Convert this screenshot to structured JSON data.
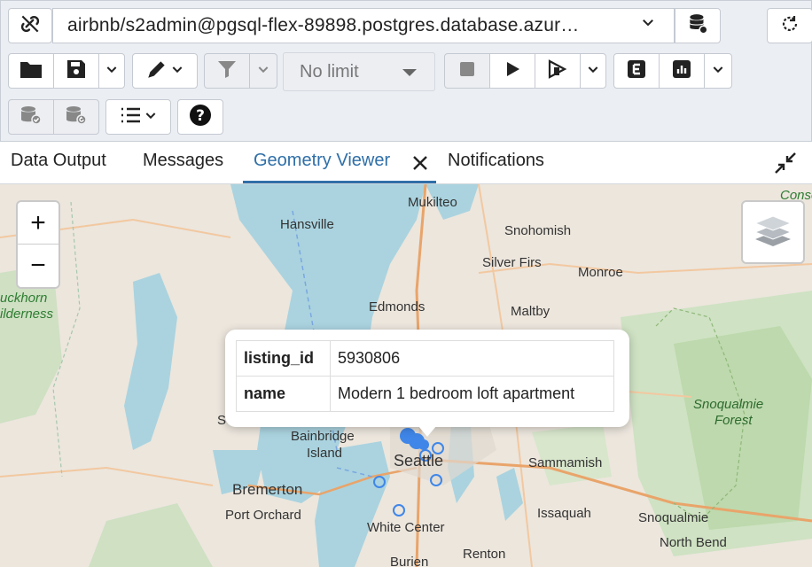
{
  "toolbar": {
    "connection": "airbnb/s2admin@pgsql-flex-89898.postgres.database.azur…",
    "limit": "No limit"
  },
  "tabs": {
    "data_output": "Data Output",
    "messages": "Messages",
    "geometry_viewer": "Geometry Viewer",
    "notifications": "Notifications"
  },
  "map": {
    "zoom_in": "+",
    "zoom_out": "−",
    "labels": {
      "mukilteo": "Mukilteo",
      "hansville": "Hansville",
      "snohomish": "Snohomish",
      "silver_firs": "Silver Firs",
      "monroe": "Monroe",
      "edmonds": "Edmonds",
      "maltby": "Maltby",
      "buckhorn": "uckhorn",
      "wilderness": "ilderness",
      "bainbridge": "Bainbridge",
      "island": "Island",
      "seattle": "Seattle",
      "sammamish": "Sammamish",
      "bremerton": "Bremerton",
      "port_orchard": "Port Orchard",
      "issaquah": "Issaquah",
      "snoqualmie": "Snoqualmie",
      "snoqualmie_forest": "Snoqualmie",
      "forest": "Forest",
      "white_center": "White Center",
      "north_bend": "North Bend",
      "renton": "Renton",
      "burien": "Burien",
      "conse": "Conse",
      "s_partial": "S"
    }
  },
  "popup": {
    "rows": [
      {
        "key": "listing_id",
        "value": "5930806"
      },
      {
        "key": "name",
        "value": "Modern 1 bedroom loft apartment"
      }
    ]
  }
}
